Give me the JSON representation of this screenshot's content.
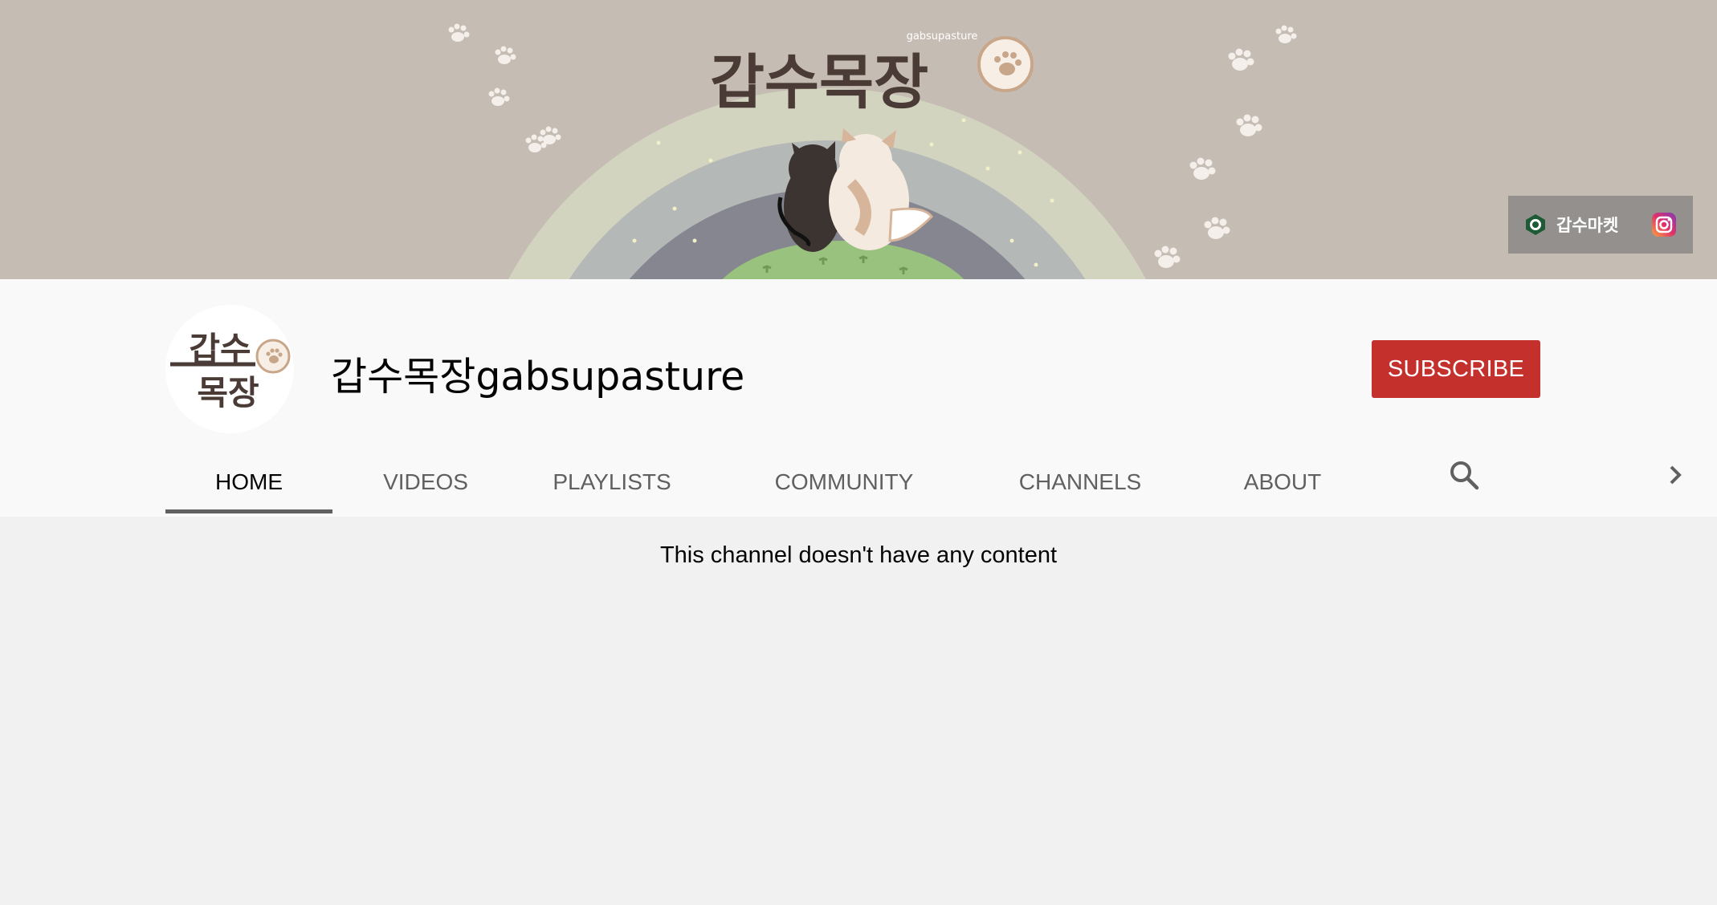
{
  "banner": {
    "title_text": "갑수목장",
    "small_caption": "gabsupasture",
    "links": [
      {
        "label": "갑수마켓",
        "icon": "market-icon"
      },
      {
        "label": "",
        "icon": "instagram-icon"
      }
    ]
  },
  "channel": {
    "avatar_text_top": "갑수",
    "avatar_text_bottom": "목장",
    "name": "갑수목장gabsupasture",
    "subscribe_label": "SUBSCRIBE"
  },
  "tabs": [
    {
      "label": "HOME",
      "active": true
    },
    {
      "label": "VIDEOS",
      "active": false
    },
    {
      "label": "PLAYLISTS",
      "active": false
    },
    {
      "label": "COMMUNITY",
      "active": false
    },
    {
      "label": "CHANNELS",
      "active": false
    },
    {
      "label": "ABOUT",
      "active": false
    }
  ],
  "icons": {
    "search": "search-icon",
    "next": "chevron-right-icon"
  },
  "content": {
    "empty_message": "This channel doesn't have any content"
  },
  "colors": {
    "subscribe": "#c4302b",
    "banner_bg": "#c5bcb3",
    "header_bg": "#f9f9f9",
    "page_bg": "#f1f1f1",
    "active_tab_underline": "#606060"
  }
}
